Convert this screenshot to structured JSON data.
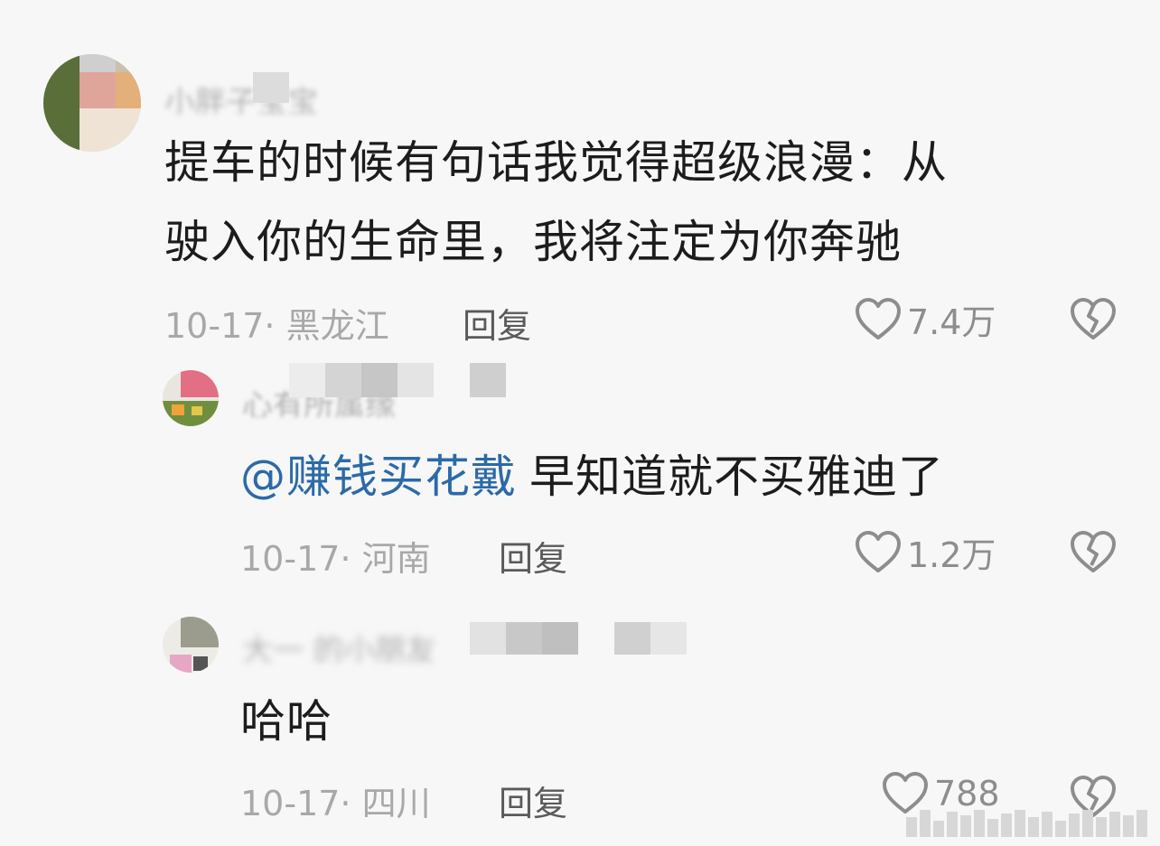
{
  "comments": [
    {
      "username": "小胖子宝宝",
      "text_line1": "提车的时候有句话我觉得超级浪漫：从",
      "text_line2": "驶入你的生命里，我将注定为你奔驰",
      "meta": "10-17· 黑龙江",
      "reply_label": "回复",
      "likes": "7.4万"
    },
    {
      "username": "心有所属缘",
      "mention": "@赚钱买花戴",
      "text": "早知道就不买雅迪了",
      "meta": "10-17· 河南",
      "reply_label": "回复",
      "likes": "1.2万"
    },
    {
      "username": "大一 的小朋友",
      "text": "哈哈",
      "meta": "10-17· 四川",
      "reply_label": "回复",
      "likes": "788"
    }
  ],
  "colors": {
    "background": "#f7f7f7",
    "text": "#1c1c1c",
    "mention": "#2b6aa8",
    "meta": "#a8a8a8",
    "icon": "#8d8d8d"
  },
  "icons": [
    "heart-icon",
    "broken-heart-icon"
  ]
}
